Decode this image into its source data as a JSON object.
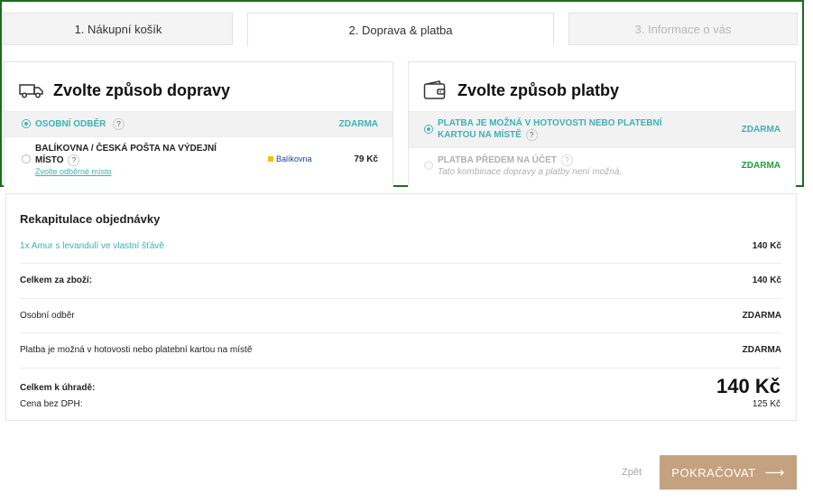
{
  "tabs": {
    "cart": "1. Nákupní košík",
    "shipping_payment": "2. Doprava & platba",
    "info": "3. Informace o vás"
  },
  "shipping": {
    "title": "Zvolte způsob dopravy",
    "icon": "truck-icon",
    "options": [
      {
        "label": "OSOBNÍ ODBĚR",
        "help": "?",
        "price": "ZDARMA",
        "selected": true
      },
      {
        "label_line1": "BALÍKOVNA / ČESKÁ POŠTA NA VÝDEJNÍ",
        "label_line2": "MÍSTO",
        "help": "?",
        "link": "Zvolte odběrné místo",
        "logo": "Balíkovna",
        "price": "79 Kč",
        "selected": false
      }
    ]
  },
  "payment": {
    "title": "Zvolte způsob platby",
    "icon": "wallet-icon",
    "options": [
      {
        "label_line1": "PLATBA JE MOŽNÁ V HOTOVOSTI NEBO PLATEBNÍ",
        "label_line2": "KARTOU NA MÍSTĚ",
        "help": "?",
        "price": "ZDARMA",
        "selected": true
      },
      {
        "label": "PLATBA PŘEDEM NA ÚČET",
        "help": "?",
        "note": "Tato kombinace dopravy a platby není možná.",
        "price": "ZDARMA",
        "selected": false,
        "disabled": true
      }
    ]
  },
  "summary": {
    "title": "Rekapitulace objednávky",
    "item": {
      "label": "1x Amur s levandulí ve vlastní šťávě",
      "value": "140 Kč"
    },
    "goods_total": {
      "label": "Celkem za zboží:",
      "value": "140 Kč"
    },
    "shipping_line": {
      "label": "Osobní odběr",
      "value": "ZDARMA"
    },
    "payment_line": {
      "label": "Platba je možná v hotovosti nebo platební kartou na místě",
      "value": "ZDARMA"
    },
    "total": {
      "label": "Celkem k úhradě:",
      "value": "140 Kč"
    },
    "no_vat": {
      "label": "Cena bez DPH:",
      "value": "125 Kč"
    }
  },
  "buttons": {
    "back": "Zpět",
    "continue": "POKRAČOVAT",
    "continue_icon": "arrow-right-icon"
  },
  "colors": {
    "accent_teal": "#3fb0b3",
    "free_green": "#1aa33a",
    "button_brown": "#c4a17f",
    "highlight_frame": "#1e6b1e"
  }
}
